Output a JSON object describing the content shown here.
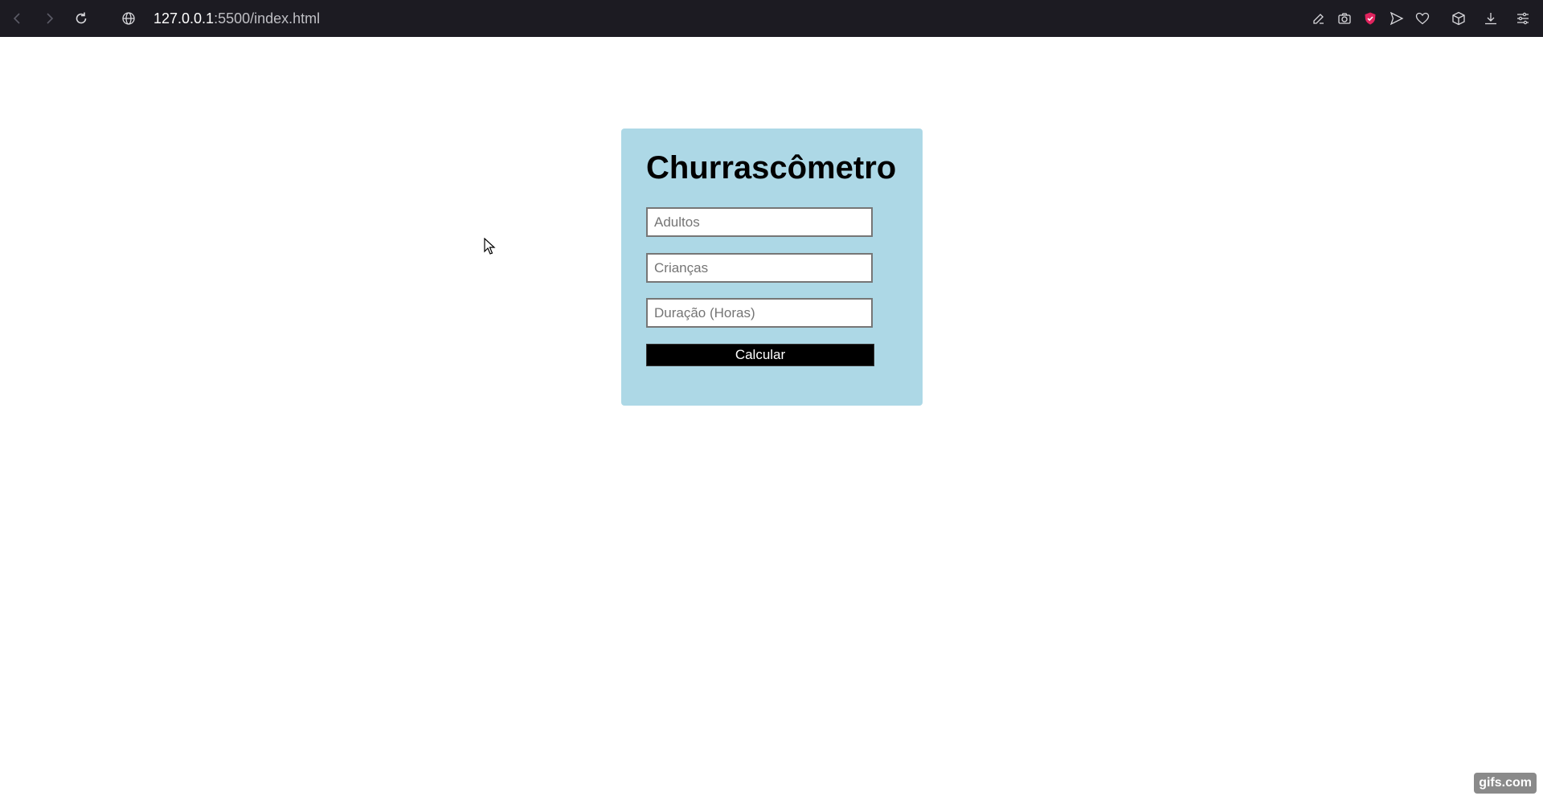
{
  "browser": {
    "url_host": "127.0.0.1",
    "url_rest": ":5500/index.html",
    "icons": [
      "back-icon",
      "forward-icon",
      "reload-icon",
      "site-info-icon",
      "edit-icon",
      "camera-icon",
      "shield-icon",
      "send-icon",
      "heart-icon",
      "cube-icon",
      "download-icon",
      "menu-icon"
    ],
    "colors": {
      "bar": "#1c1b22",
      "shield": "#e0245e"
    }
  },
  "app": {
    "title": "Churrascômetro",
    "fields": {
      "adults_placeholder": "Adultos",
      "children_placeholder": "Crianças",
      "duration_placeholder": "Duração (Horas)"
    },
    "calculate_label": "Calcular",
    "colors": {
      "card": "#add8e6",
      "button": "#000000"
    }
  },
  "watermark": "gifs.com"
}
